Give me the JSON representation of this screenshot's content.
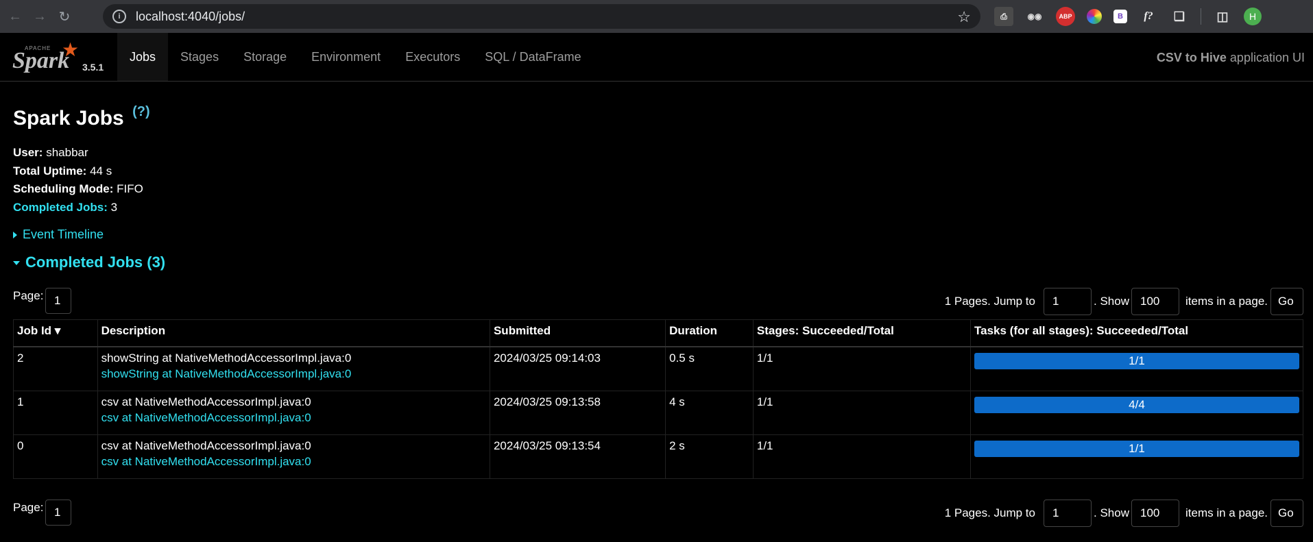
{
  "browser": {
    "url": "localhost:4040/jobs/",
    "avatar_letter": "H",
    "extensions": [
      "printer-icon",
      "spy-icon",
      "adblock-icon",
      "colorwheel-icon",
      "bootstrap-icon",
      "formula-icon",
      "puzzle-icon",
      "sidepanel-icon"
    ]
  },
  "nav": {
    "version": "3.5.1",
    "tabs": [
      "Jobs",
      "Stages",
      "Storage",
      "Environment",
      "Executors",
      "SQL / DataFrame"
    ],
    "active_tab": "Jobs",
    "app_name_bold": "CSV to Hive",
    "app_name_suffix": " application UI"
  },
  "page": {
    "title": "Spark Jobs",
    "help": "(?)",
    "user_label": "User:",
    "user": "shabbar",
    "uptime_label": "Total Uptime:",
    "uptime": "44 s",
    "sched_label": "Scheduling Mode:",
    "sched": "FIFO",
    "completed_label": "Completed Jobs:",
    "completed": "3",
    "event_timeline": "Event Timeline",
    "section_title": "Completed Jobs (3)"
  },
  "pager": {
    "page_label": "Page:",
    "page": "1",
    "pages_text": "1 Pages. Jump to",
    "jump_value": "1",
    "show_text": ". Show",
    "show_value": "100",
    "items_text": "items in a page.",
    "go": "Go"
  },
  "table": {
    "headers": [
      "Job Id ▾",
      "Description",
      "Submitted",
      "Duration",
      "Stages: Succeeded/Total",
      "Tasks (for all stages): Succeeded/Total"
    ],
    "rows": [
      {
        "id": "2",
        "desc": "showString at NativeMethodAccessorImpl.java:0",
        "link": "showString at NativeMethodAccessorImpl.java:0",
        "submitted": "2024/03/25 09:14:03",
        "duration": "0.5 s",
        "stages": "1/1",
        "tasks": "1/1",
        "tasks_fraction": 1.0
      },
      {
        "id": "1",
        "desc": "csv at NativeMethodAccessorImpl.java:0",
        "link": "csv at NativeMethodAccessorImpl.java:0",
        "submitted": "2024/03/25 09:13:58",
        "duration": "4 s",
        "stages": "1/1",
        "tasks": "4/4",
        "tasks_fraction": 1.0
      },
      {
        "id": "0",
        "desc": "csv at NativeMethodAccessorImpl.java:0",
        "link": "csv at NativeMethodAccessorImpl.java:0",
        "submitted": "2024/03/25 09:13:54",
        "duration": "2 s",
        "stages": "1/1",
        "tasks": "1/1",
        "tasks_fraction": 1.0
      }
    ]
  },
  "colors": {
    "accent": "#32e0f0",
    "progress": "#0d6bc9",
    "background": "#000000"
  }
}
